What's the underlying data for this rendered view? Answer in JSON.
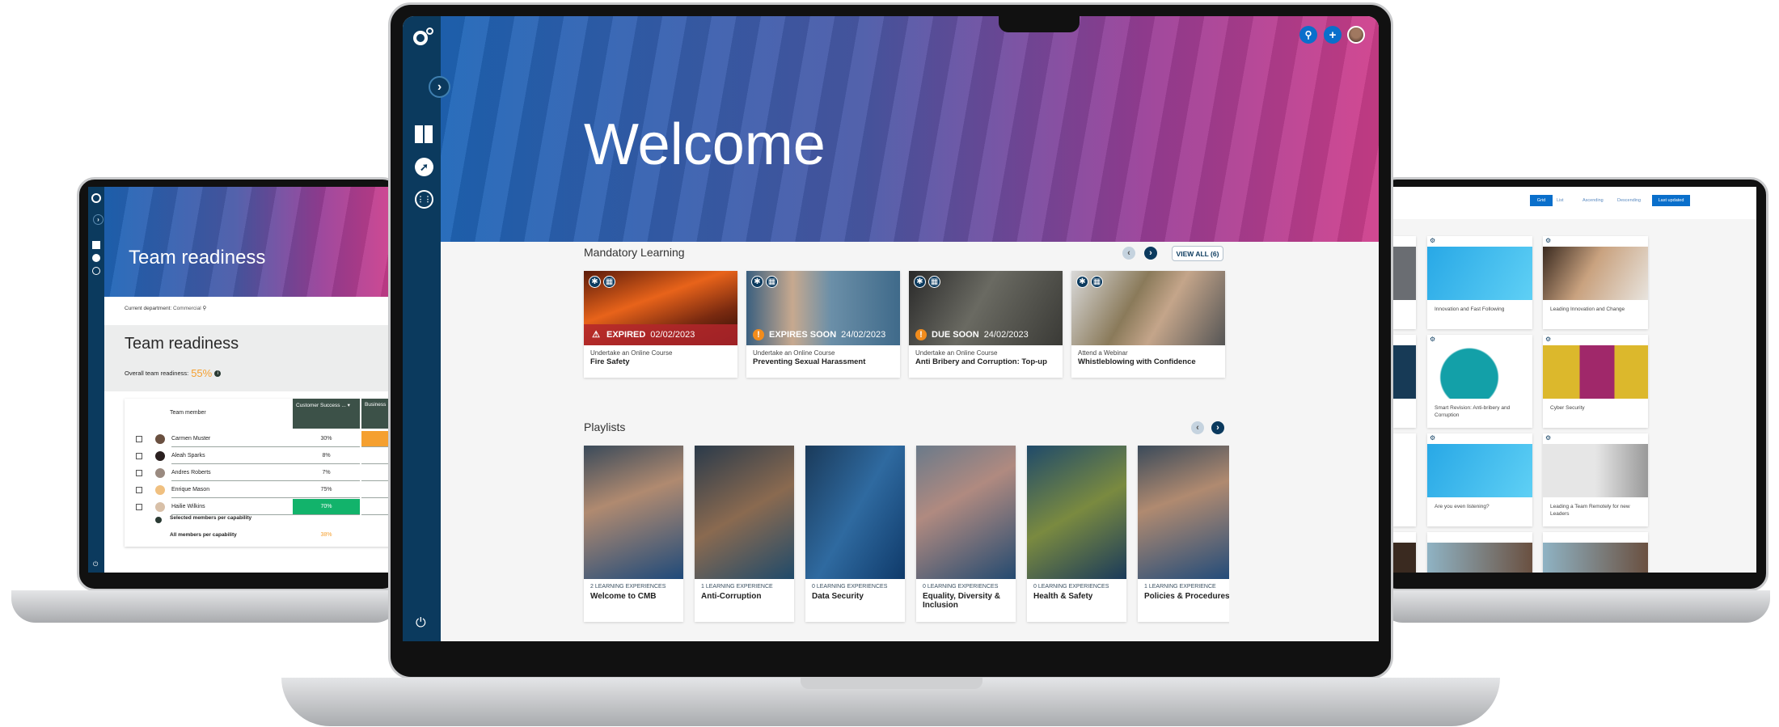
{
  "main": {
    "hero_title": "Welcome",
    "sidebar": {
      "icons": [
        "logo-icon",
        "chevron-right-icon",
        "dashboard-icon",
        "compass-icon",
        "grid-icon",
        "power-icon"
      ]
    },
    "topbar": {
      "icons": [
        "search-icon",
        "plus-icon",
        "avatar"
      ]
    },
    "mandatory": {
      "title": "Mandatory Learning",
      "view_all": "VIEW ALL (6)",
      "cards": [
        {
          "status": "EXPIRED",
          "date": "02/02/2023",
          "type": "Undertake an Online Course",
          "title": "Fire Safety",
          "status_color": "#b3262c",
          "img": "linear-gradient(160deg,#5a1a0a,#e8631a 40%,#7a2a10 70%,#2a0a05)"
        },
        {
          "status": "EXPIRES SOON",
          "date": "24/02/2023",
          "type": "Undertake an Online Course",
          "title": "Preventing Sexual Harassment",
          "status_color": "#f28c1c",
          "img": "linear-gradient(90deg,#3a5f7f,#c7a98f 30%,#6b8fa8 55%,#3f6a8a)"
        },
        {
          "status": "DUE SOON",
          "date": "24/02/2023",
          "type": "Undertake an Online Course",
          "title": "Anti Bribery and Corruption: Top-up",
          "status_color": "#f28c1c",
          "img": "linear-gradient(120deg,#2a2a2a,#6a6a62 45%,#3a3a36)"
        },
        {
          "status": "",
          "date": "",
          "type": "Attend a Webinar",
          "title": "Whistleblowing with Confidence",
          "status_color": "",
          "img": "linear-gradient(120deg,#d9d9d9,#8a7a5a 40%,#c4a58a 60%,#555)"
        }
      ]
    },
    "playlists": {
      "title": "Playlists",
      "cards": [
        {
          "count": "2 LEARNING EXPERIENCES",
          "title": "Welcome to CMB"
        },
        {
          "count": "1 LEARNING EXPERIENCE",
          "title": "Anti-Corruption"
        },
        {
          "count": "0 LEARNING EXPERIENCES",
          "title": "Data Security"
        },
        {
          "count": "0 LEARNING EXPERIENCES",
          "title": "Equality, Diversity & Inclusion"
        },
        {
          "count": "0 LEARNING EXPERIENCES",
          "title": "Health & Safety"
        },
        {
          "count": "1 LEARNING EXPERIENCE",
          "title": "Policies & Procedures"
        }
      ]
    }
  },
  "left": {
    "hero_title": "Team readiness",
    "department_label": "Current department:",
    "department_value": "Commercial",
    "title": "Team readiness",
    "overall_label": "Overall team readiness:",
    "overall_value": "55%",
    "col_member": "Team member",
    "col_cap1": "Customer Success ...",
    "col_cap2": "Business",
    "members": [
      {
        "name": "Carmen Muster",
        "value": "30%"
      },
      {
        "name": "Aleah Sparks",
        "value": "8%"
      },
      {
        "name": "Andres Roberts",
        "value": "7%"
      },
      {
        "name": "Enrique Mason",
        "value": "75%"
      },
      {
        "name": "Hailie Wilkins",
        "value": "70%"
      }
    ],
    "selected_label": "Selected members per capability",
    "all_label": "All members per capability",
    "all_value": "38%",
    "colors": {
      "header": "#3c5148",
      "orange": "#f5a030",
      "green": "#12b36b"
    }
  },
  "right": {
    "toolbar": {
      "grid": "Grid",
      "list": "List",
      "ascending": "Ascending",
      "descending": "Descending",
      "last_updated": "Last updated"
    },
    "cards": [
      {
        "title": "Innovation and Fast Following",
        "img": "linear-gradient(120deg,#28a8e6,#5fd0f5)"
      },
      {
        "title": "Leading Innovation and Change",
        "img": "linear-gradient(120deg,#3a2a20,#c9a27f 45%,#e8e4de)"
      },
      {
        "title": "Smart Revision: Anti-bribery and Corruption",
        "img": "radial-gradient(circle at 40% 60%,#13a0a8 40%,#fff 42%)"
      },
      {
        "title": "Cyber Security",
        "img": "linear-gradient(90deg,#dcb82c 35%,#a0286a 35%,#a0286a 68%,#dcb82c 68%)"
      },
      {
        "title": "Are you even listening?",
        "img": "linear-gradient(120deg,#28a8e6,#5fd0f5)"
      },
      {
        "title": "Leading a Team Remotely for new Leaders",
        "img": "linear-gradient(90deg,#e6e6e6 50%,#999)"
      }
    ]
  },
  "colors": {
    "navy": "#0b3a5e",
    "accent": "#0a6fcb",
    "background": "#f5f5f5"
  }
}
